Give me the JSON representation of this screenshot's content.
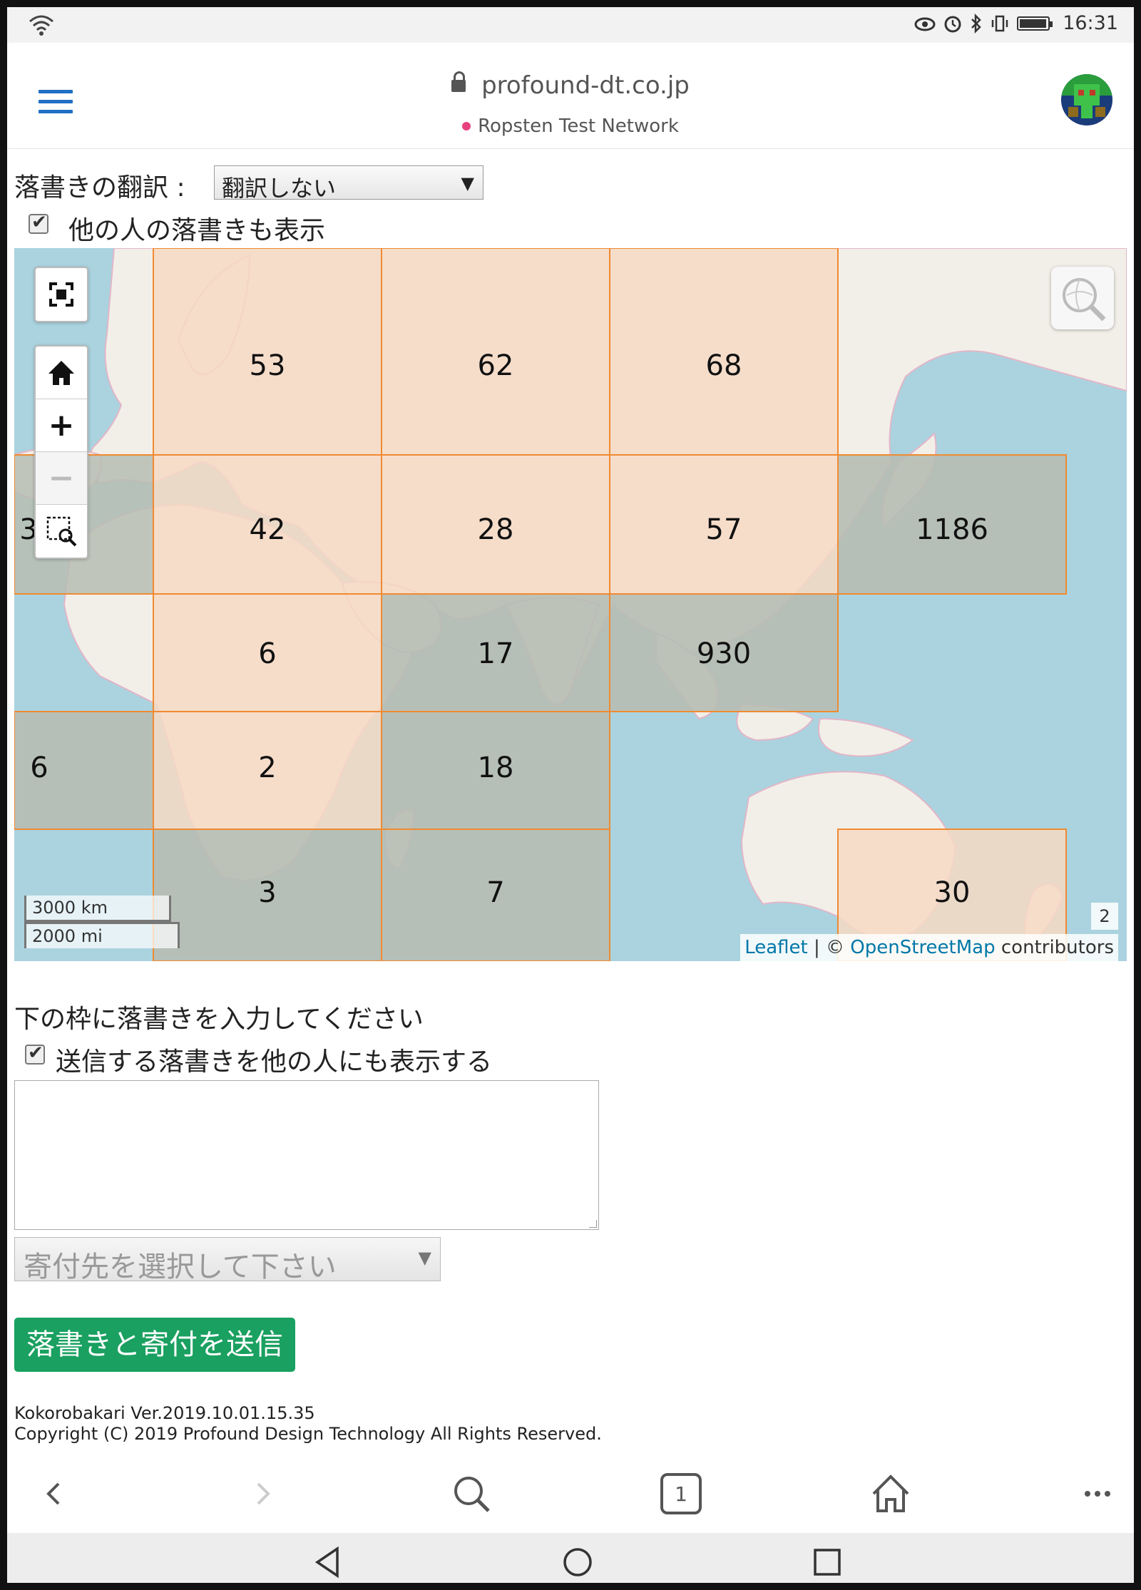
{
  "status_bar": {
    "time": "16:31"
  },
  "header": {
    "url": "profound-dt.co.jp",
    "network": "Ropsten Test Network"
  },
  "translation": {
    "label": "落書きの翻訳 :",
    "selected": "翻訳しない"
  },
  "show_others": {
    "label": "他の人の落書きも表示",
    "checked": true
  },
  "map": {
    "cells": [
      {
        "label": "53"
      },
      {
        "label": "62"
      },
      {
        "label": "68"
      },
      {
        "label": "3"
      },
      {
        "label": "42"
      },
      {
        "label": "28"
      },
      {
        "label": "57"
      },
      {
        "label": "1186"
      },
      {
        "label": "6"
      },
      {
        "label": "17"
      },
      {
        "label": "930"
      },
      {
        "label": "6"
      },
      {
        "label": "2"
      },
      {
        "label": "18"
      },
      {
        "label": "3"
      },
      {
        "label": "7"
      },
      {
        "label": "30"
      }
    ],
    "colors": {
      "land_highlight": "#f7d9c4",
      "sea_dim": "#b7bdb3",
      "grid_line": "#f08a30",
      "sea": "#aad3df",
      "land": "#f2efe9"
    },
    "scale_km": "3000 km",
    "scale_mi": "2000 mi",
    "zoom": "2",
    "attribution": {
      "leaflet": "Leaflet",
      "sep": " | © ",
      "osm": "OpenStreetMap",
      "suffix": " contributors"
    }
  },
  "form": {
    "prompt": "下の枠に落書きを入力してください",
    "share_label": "送信する落書きを他の人にも表示する",
    "share_checked": true,
    "textarea_value": "",
    "donation_placeholder": "寄付先を選択して下さい",
    "submit_label": "落書きと寄付を送信"
  },
  "footer": {
    "version": "Kokorobakari Ver.2019.10.01.15.35",
    "copyright": "Copyright (C) 2019 Profound Design Technology All Rights Reserved."
  },
  "browser_nav": {
    "tab_count": "1"
  }
}
